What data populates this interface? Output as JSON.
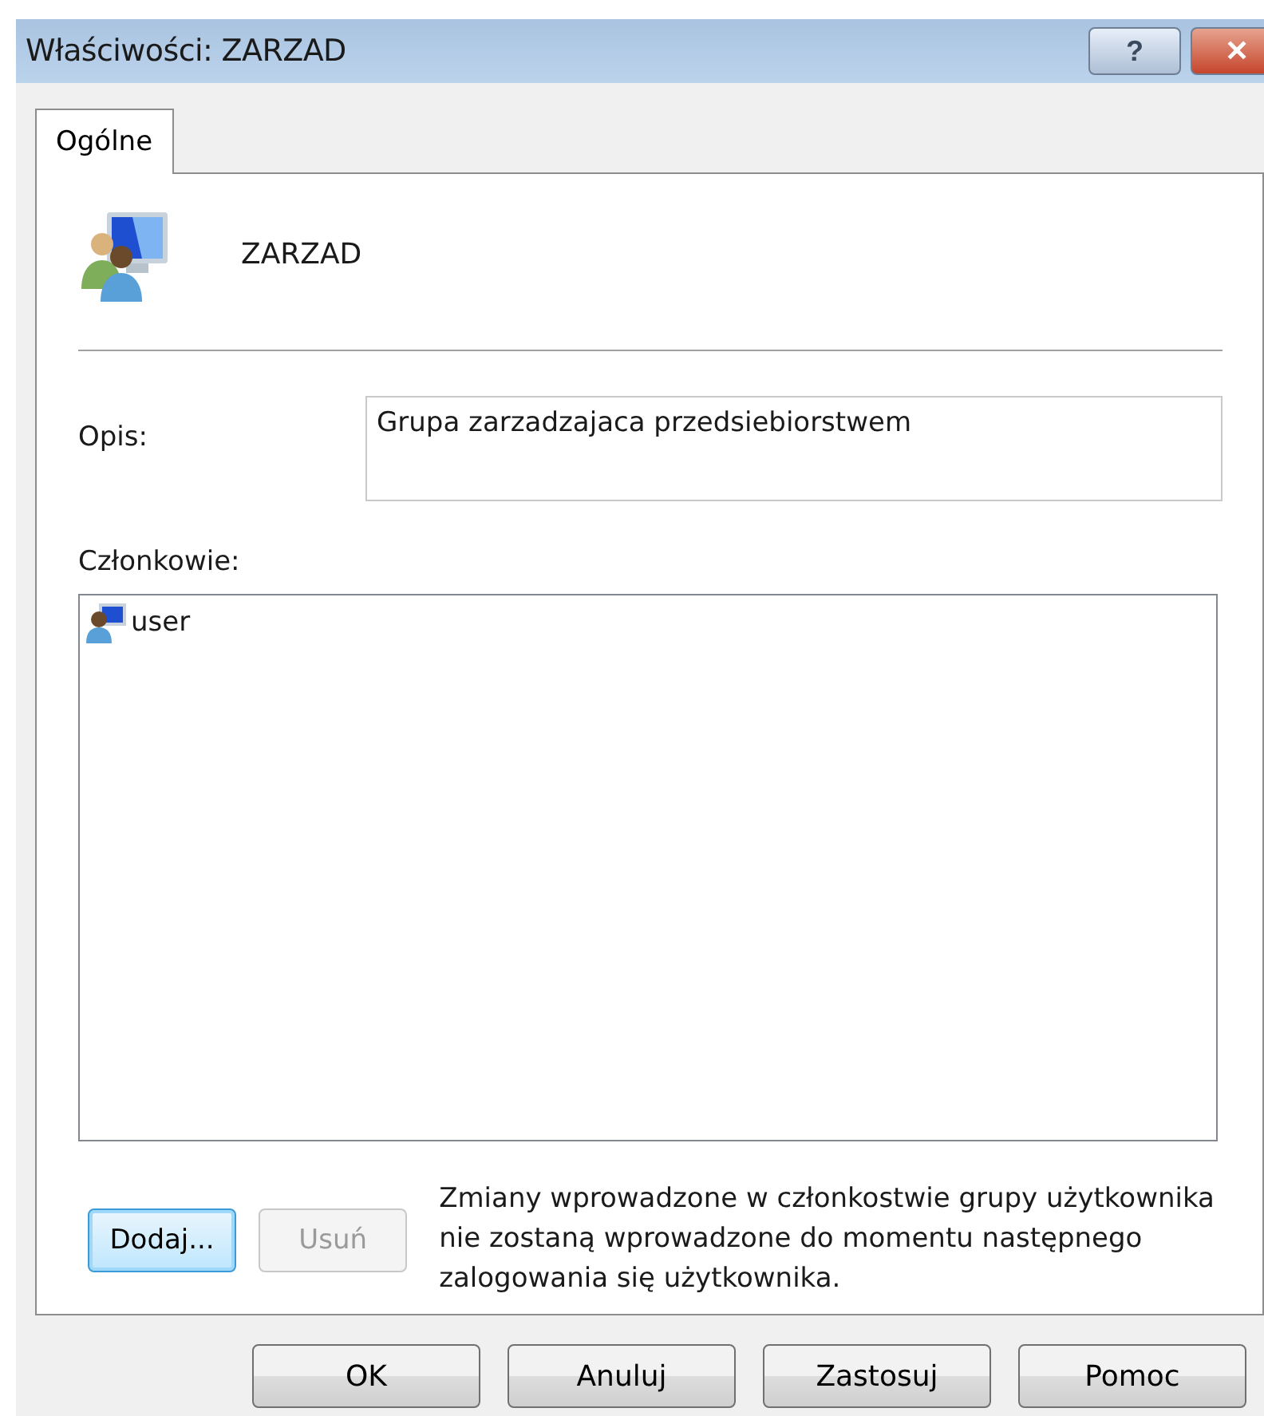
{
  "window": {
    "title": "Właściwości: ZARZAD",
    "help_button": "?",
    "close_button": "✕"
  },
  "tabs": [
    {
      "label": "Ogólne",
      "selected": true
    }
  ],
  "group": {
    "name": "ZARZAD"
  },
  "description": {
    "label": "Opis:",
    "value": "Grupa zarzadzajaca przedsiebiorstwem"
  },
  "members": {
    "label": "Członkowie:",
    "items": [
      {
        "name": "user",
        "selected": false
      }
    ]
  },
  "member_buttons": [
    {
      "label": "Dodaj...",
      "focused": true,
      "disabled": false
    },
    {
      "label": "Usuń",
      "focused": false,
      "disabled": true
    }
  ],
  "note": "Zmiany wprowadzone w członkostwie grupy użytkownika nie zostaną wprowadzone do momentu następnego zalogowania się użytkownika.",
  "buttons": [
    "OK",
    "Anuluj",
    "Zastosuj",
    "Pomoc"
  ]
}
